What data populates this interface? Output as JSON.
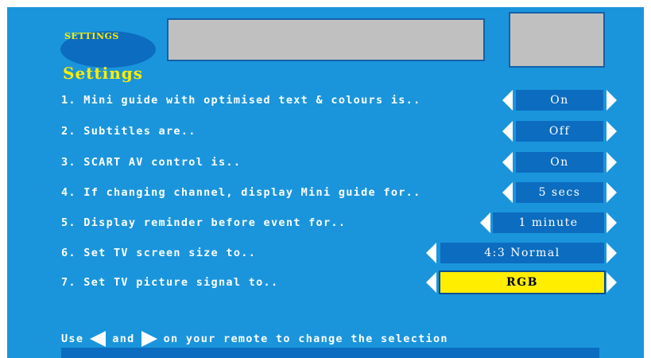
{
  "header": {
    "logo_text": "SETTINGS",
    "title": "Settings"
  },
  "settings": [
    {
      "label": "1. Mini guide with optimised text & colours is..",
      "value": "On"
    },
    {
      "label": "2. Subtitles are..",
      "value": "Off"
    },
    {
      "label": "3. SCART AV control is..",
      "value": "On"
    },
    {
      "label": "4. If changing channel, display Mini guide for..",
      "value": "5 secs"
    },
    {
      "label": "5. Display reminder before event for..",
      "value": "1 minute"
    },
    {
      "label": "6. Set TV screen size to..",
      "value": "4:3 Normal"
    },
    {
      "label": "7. Set TV picture signal to..",
      "value": "RGB",
      "selected": true
    }
  ],
  "footer": {
    "use": "Use",
    "and": "and",
    "rest": "on your remote to change the selection"
  },
  "colors": {
    "background": "#1a95dc",
    "value_box": "#0c6cbf",
    "highlight": "#ffee00",
    "title": "#ffec00"
  },
  "icons": [
    "left-arrow-icon",
    "right-arrow-icon"
  ]
}
